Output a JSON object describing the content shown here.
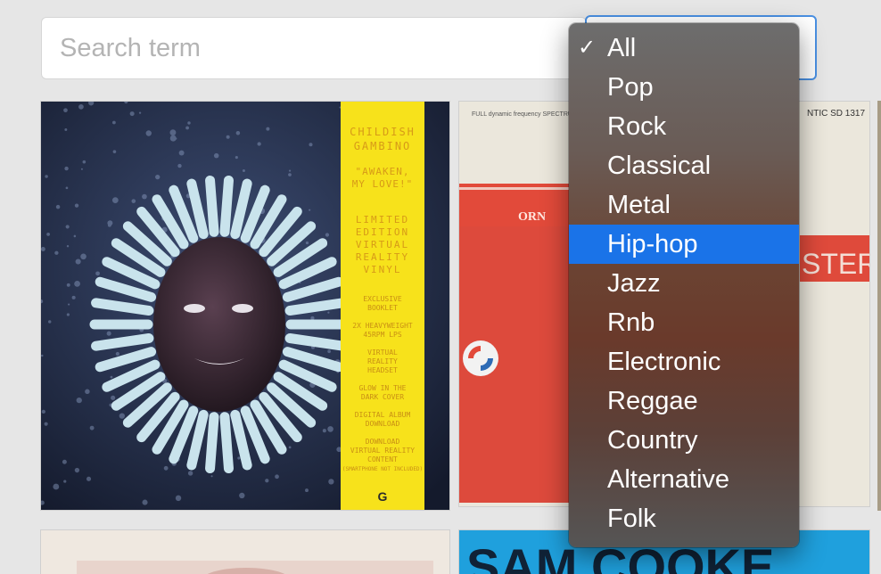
{
  "search": {
    "placeholder": "Search term",
    "value": ""
  },
  "genre_select": {
    "selected": "All",
    "highlighted": "Hip-hop",
    "options": [
      "All",
      "Pop",
      "Rock",
      "Classical",
      "Metal",
      "Hip-hop",
      "Jazz",
      "Rnb",
      "Electronic",
      "Reggae",
      "Country",
      "Alternative",
      "Folk"
    ]
  },
  "albums": [
    {
      "artist": "CHILDISH GAMBINO",
      "title": "\"AWAKEN, MY LOVE!\"",
      "edition": "LIMITED EDITION VIRTUAL REALITY VINYL",
      "features": [
        "EXCLUSIVE BOOKLET",
        "2X HEAVYWEIGHT 45RPM LPS",
        "VIRTUAL REALITY HEADSET",
        "GLOW IN THE DARK COVER",
        "DIGITAL ALBUM DOWNLOAD",
        "DOWNLOAD VIRTUAL REALITY CONTENT"
      ],
      "note": "(SMARTPHONE NOT INCLUDED)",
      "label_logo": "G"
    },
    {
      "top_left": "FULL dynamic frequency SPECTRUM",
      "catalog": "NTIC SD 1317",
      "name_fragment": "ORN",
      "stereo": "STEREO"
    },
    {},
    {},
    {
      "artist": "SAM COOKE"
    }
  ],
  "colors": {
    "sticker": "#f7e21b",
    "accent": "#1a73e8",
    "select_border": "#4a90e2"
  }
}
